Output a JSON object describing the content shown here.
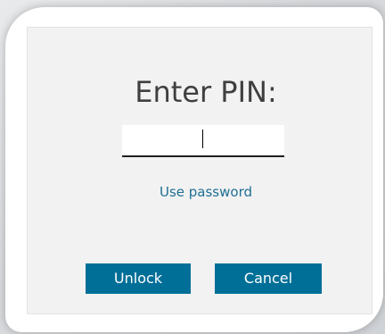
{
  "dialog": {
    "title": "Enter PIN:",
    "pin_value": "",
    "use_password_link": "Use password",
    "unlock_label": "Unlock",
    "cancel_label": "Cancel"
  },
  "colors": {
    "panel_background": "#f2f2f2",
    "button_background": "#006f98",
    "link_color": "#1f6f95",
    "title_color": "#3f3f3f"
  }
}
